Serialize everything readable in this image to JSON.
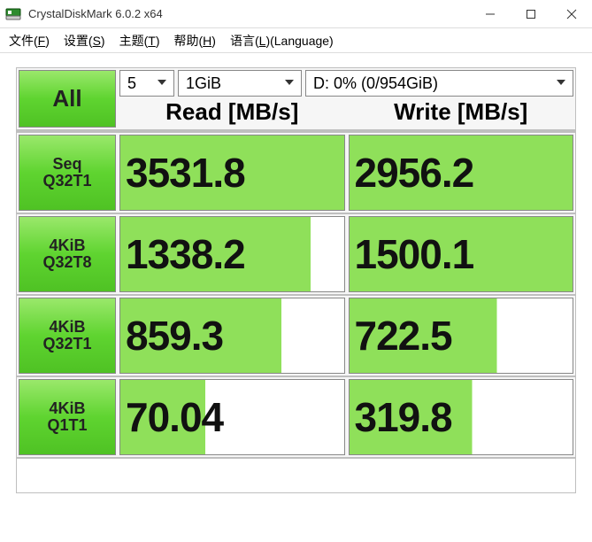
{
  "window": {
    "title": "CrystalDiskMark 6.0.2 x64"
  },
  "menu": {
    "file": {
      "label": "文件",
      "accel": "F"
    },
    "config": {
      "label": "设置",
      "accel": "S"
    },
    "theme": {
      "label": "主题",
      "accel": "T"
    },
    "help": {
      "label": "帮助",
      "accel": "H"
    },
    "lang": {
      "label": "语言",
      "accel": "L",
      "suffix": "(Language)"
    }
  },
  "controls": {
    "all_label": "All",
    "test_count": "5",
    "test_size": "1GiB",
    "drive": "D: 0% (0/954GiB)"
  },
  "headers": {
    "read": "Read [MB/s]",
    "write": "Write [MB/s]"
  },
  "tests": [
    {
      "line1": "Seq",
      "line2": "Q32T1",
      "read": "3531.8",
      "write": "2956.2",
      "read_fill": 100,
      "write_fill": 100
    },
    {
      "line1": "4KiB",
      "line2": "Q32T8",
      "read": "1338.2",
      "write": "1500.1",
      "read_fill": 85,
      "write_fill": 100
    },
    {
      "line1": "4KiB",
      "line2": "Q32T1",
      "read": "859.3",
      "write": "722.5",
      "read_fill": 72,
      "write_fill": 66
    },
    {
      "line1": "4KiB",
      "line2": "Q1T1",
      "read": "70.04",
      "write": "319.8",
      "read_fill": 38,
      "write_fill": 55
    }
  ]
}
